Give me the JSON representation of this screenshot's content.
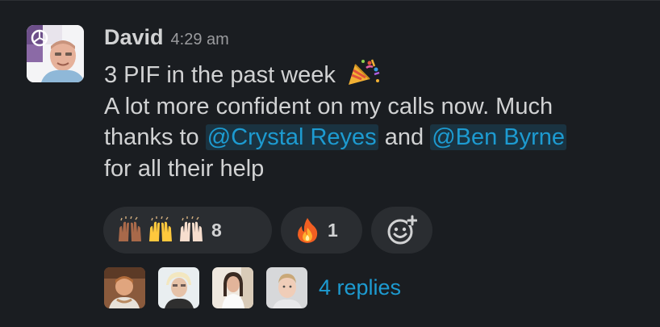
{
  "message": {
    "author": "David",
    "timestamp": "4:29 am",
    "lines": {
      "line1_text": "3 PIF in the past week",
      "line1_emoji": "party-popper",
      "line2_text": "A lot more confident on my calls now. Much",
      "line3_prefix": "thanks to ",
      "mention1": "@Crystal Reyes",
      "line3_middle": " and ",
      "mention2": "@Ben Byrne",
      "line4_text": "for all their help"
    }
  },
  "reactions": [
    {
      "emojis": [
        "raised-hands-medium-dark",
        "raised-hands-yellow",
        "raised-hands-light"
      ],
      "count": "8"
    },
    {
      "emojis": [
        "fire"
      ],
      "count": "1"
    }
  ],
  "thread": {
    "replies_label": "4 replies",
    "participant_count": 4
  },
  "colors": {
    "background": "#1a1d21",
    "text": "#d1d2d3",
    "link": "#1d9bd1",
    "timestamp": "#9a9b9e",
    "reaction_bg": "#2a2d31"
  }
}
